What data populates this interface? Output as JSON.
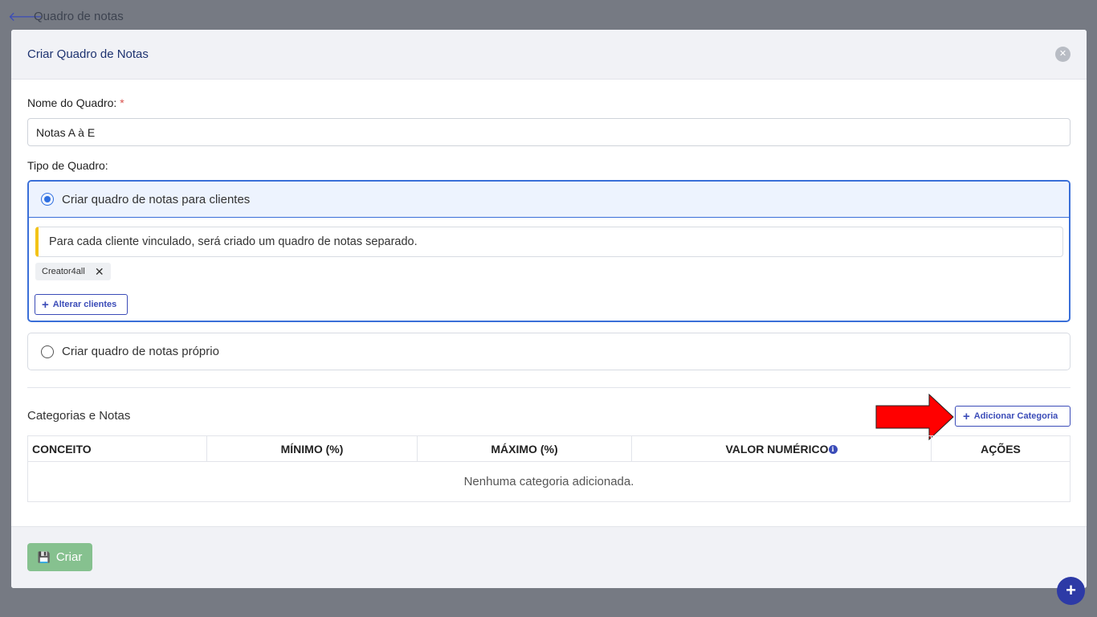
{
  "topbar": {
    "back_icon": "arrow-left-icon",
    "title": "Quadro de notas"
  },
  "modal": {
    "title": "Criar Quadro de Notas",
    "close_icon": "close-icon",
    "name_label": "Nome do Quadro:",
    "required_mark": "*",
    "name_value": "Notas A à E",
    "type_label": "Tipo de Quadro:",
    "option_clients": {
      "label": "Criar quadro de notas para clientes",
      "selected": true,
      "info": "Para cada cliente vinculado, será criado um quadro de notas separado.",
      "chip": "Creator4all",
      "chip_remove": "✕",
      "change_button": "Alterar clientes"
    },
    "option_own": {
      "label": "Criar quadro de notas próprio",
      "selected": false
    },
    "categories_title": "Categorias e Notas",
    "add_category_button": "Adicionar Categoria",
    "table": {
      "headers": [
        "CONCEITO",
        "MÍNIMO (%)",
        "MÁXIMO (%)",
        "VALOR NUMÉRICO",
        "AÇÕES"
      ],
      "empty_text": "Nenhuma categoria adicionada."
    },
    "create_button": "Criar"
  },
  "colors": {
    "accent": "#3b4cb8",
    "selected_border": "#3a6fd8",
    "create_button": "#86c18f",
    "warning_bar": "#f3c317",
    "arrow": "#ff0000"
  }
}
